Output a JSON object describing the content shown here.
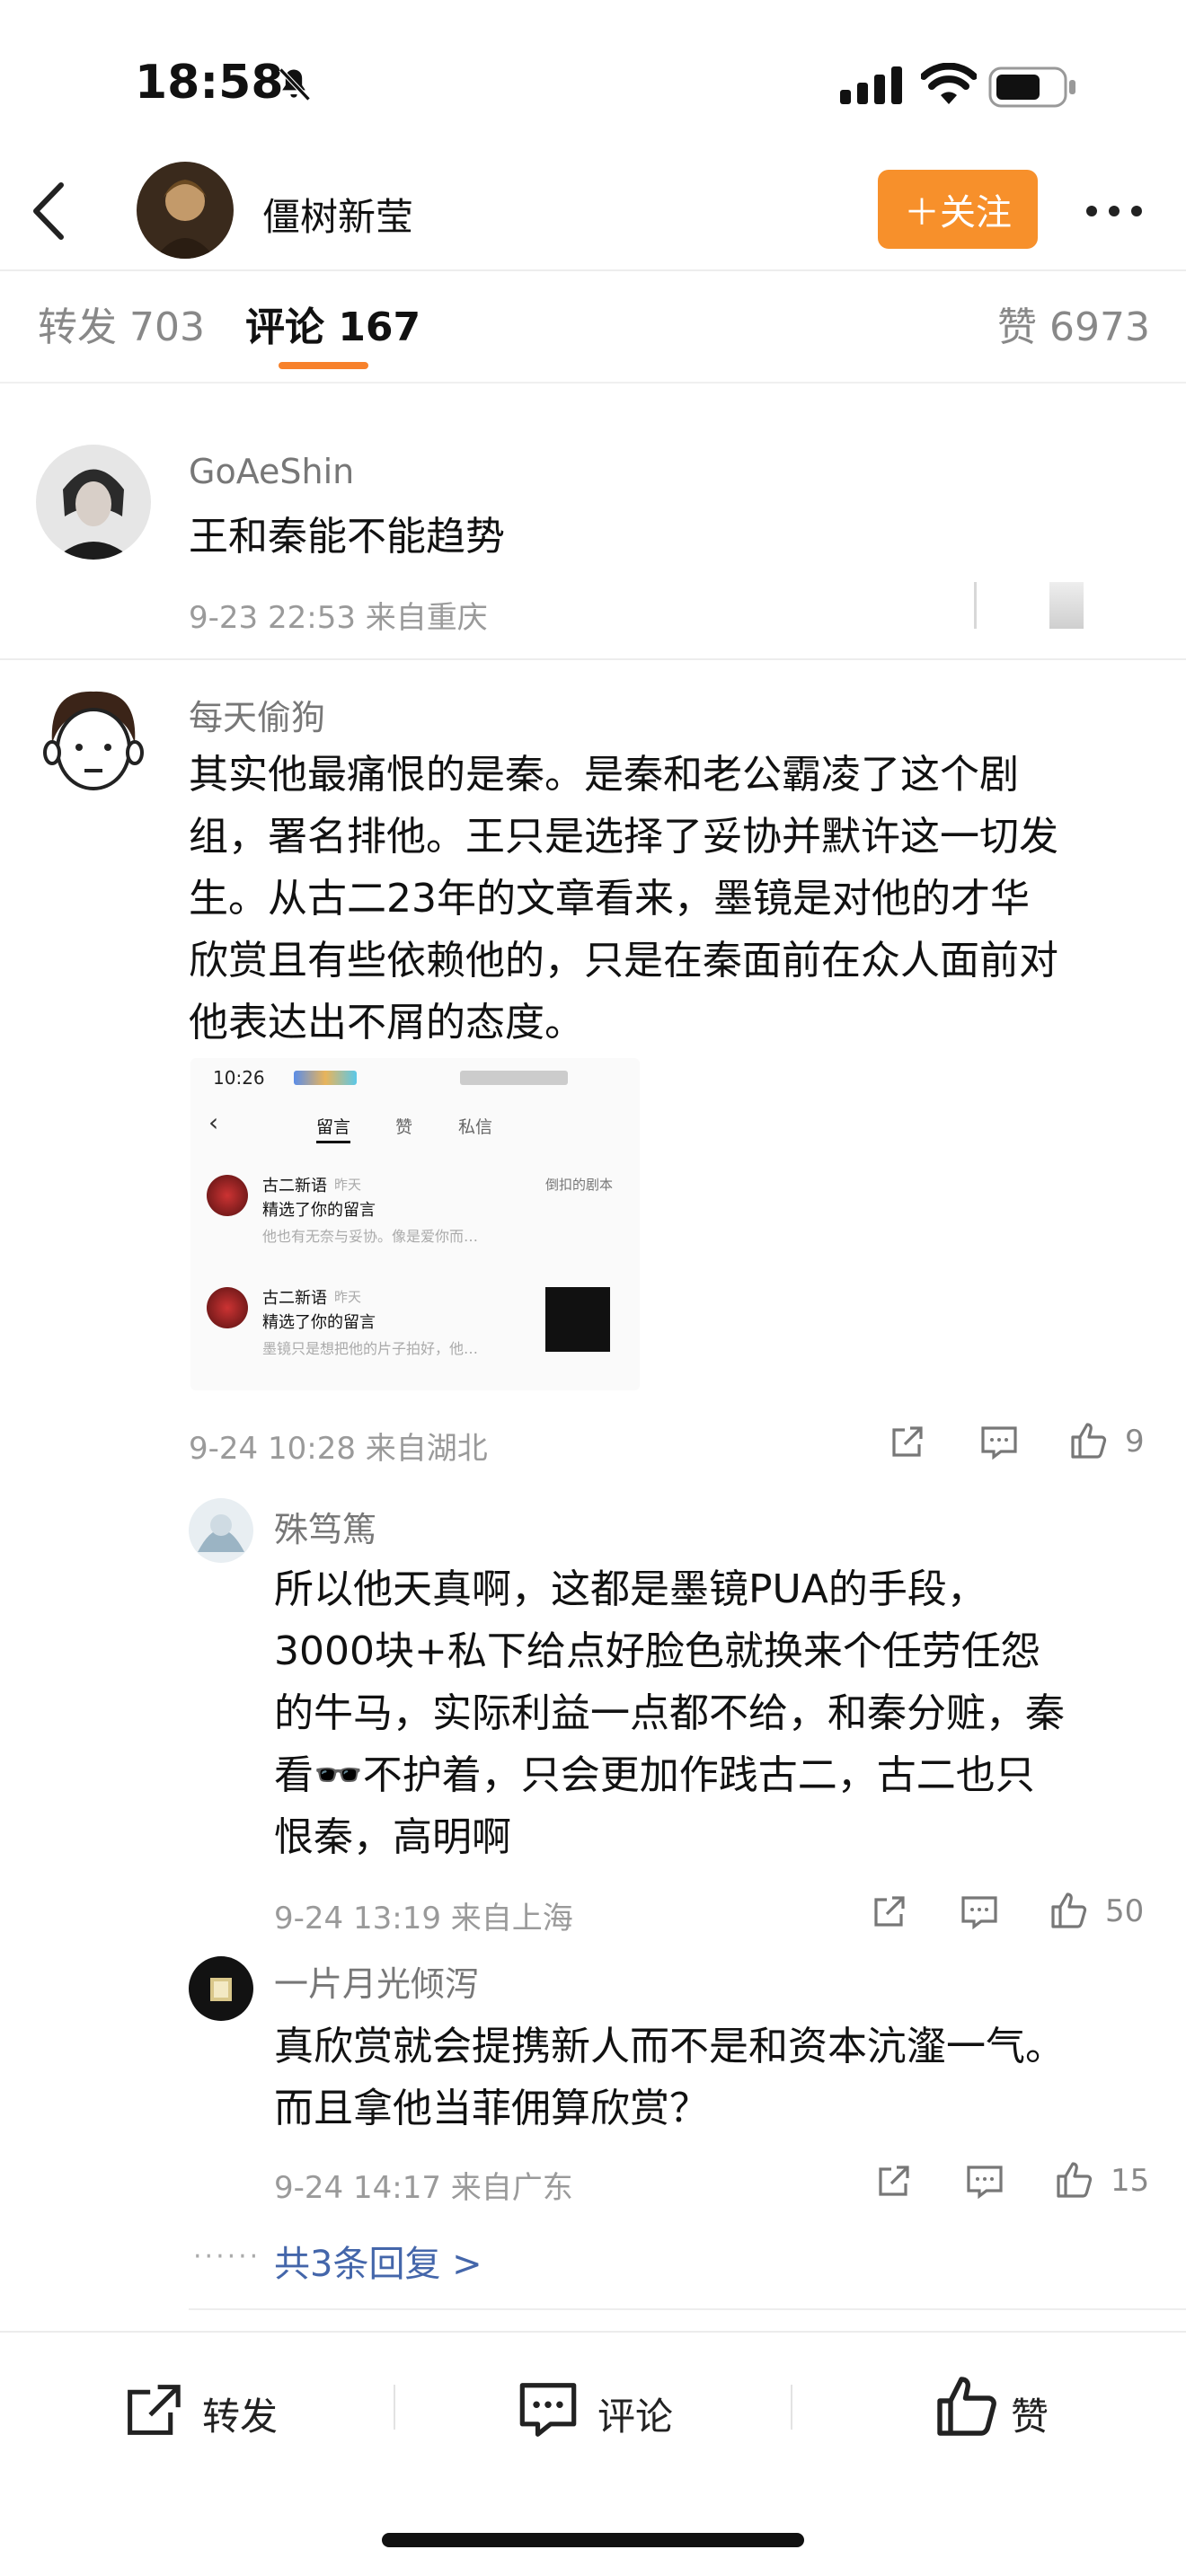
{
  "status": {
    "time": "18:58",
    "battery": ""
  },
  "nav": {
    "title": "僵树新莹",
    "follow": "＋关注"
  },
  "tabs": {
    "repost": "转发 703",
    "comments": "评论 167",
    "likes": "赞 6973"
  },
  "comments": [
    {
      "user": "GoAeShin",
      "text": "王和秦能不能趋势",
      "meta": "9-23 22:53  来自重庆"
    },
    {
      "user": "每天偷狗",
      "lines": [
        "其实他最痛恨的是秦。是秦和老公霸凌了这个剧",
        "组，署名排他。王只是选择了妥协并默许这一切发",
        "生。从古二23年的文章看来，墨镜是对他的才华",
        "欣赏且有些依赖他的，只是在秦面前在众人面前对",
        "他表达出不屑的态度。"
      ],
      "meta": "9-24 10:28  来自湖北",
      "likes": "9"
    }
  ],
  "screenshot": {
    "time": "10:26",
    "tabs": [
      "留言",
      "赞",
      "私信"
    ],
    "items": [
      {
        "name": "古二新语",
        "when": "昨天",
        "action": "精选了你的留言",
        "snippet": "他也有无奈与妥协。像是爱你而…",
        "source": "倒扣的剧本"
      },
      {
        "name": "古二新语",
        "when": "昨天",
        "action": "精选了你的留言",
        "snippet": "墨镜只是想把他的片子拍好，他…"
      }
    ]
  },
  "replies": [
    {
      "user": "殊笃篤",
      "lines": [
        "所以他天真啊，这都是墨镜PUA的手段，",
        "3000块+私下给点好脸色就换来个任劳任怨",
        "的牛马，实际利益一点都不给，和秦分赃，秦",
        "看🕶️不护着，只会更加作践古二，古二也只",
        "恨秦，高明啊"
      ],
      "meta": "9-24 13:19  来自上海",
      "likes": "50"
    },
    {
      "user": "一片月光倾泻",
      "lines": [
        "真欣赏就会提携新人而不是和资本沆瀣一气。",
        "而且拿他当菲佣算欣赏？"
      ],
      "meta": "9-24 14:17  来自广东",
      "likes": "15"
    }
  ],
  "more_replies": "共3条回复 >",
  "bottom": {
    "repost": "转发",
    "comment": "评论",
    "like": "赞"
  }
}
